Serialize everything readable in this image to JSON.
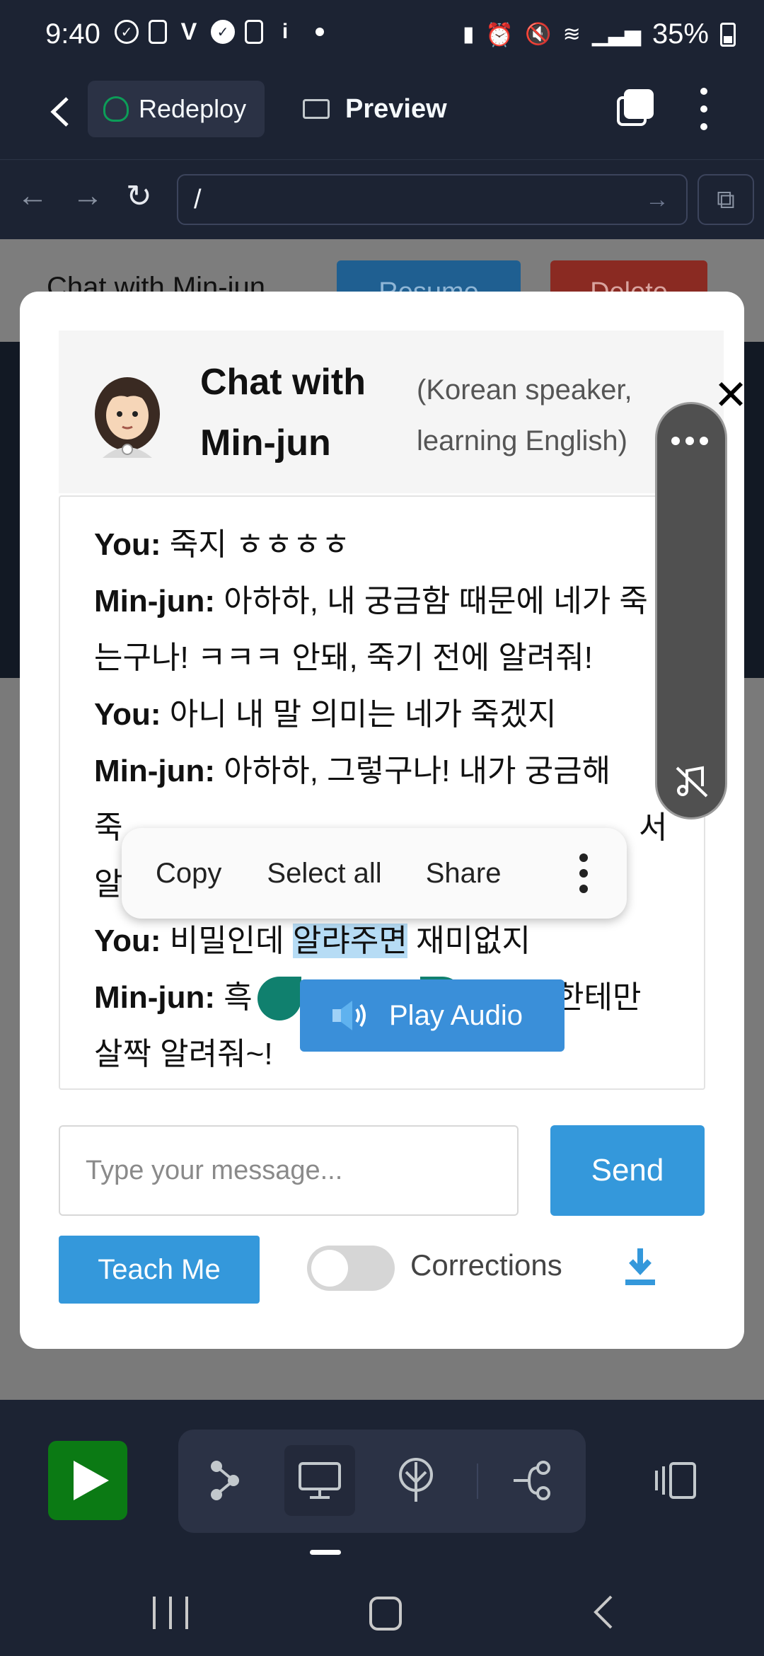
{
  "status_bar": {
    "time": "9:40",
    "battery": "35%"
  },
  "app_bar": {
    "redeploy_label": "Redeploy",
    "preview_label": "Preview"
  },
  "url_bar": {
    "path": "/"
  },
  "background_page": {
    "title": "Chat with Min-jun",
    "resume_label": "Resume",
    "delete_label": "Delete"
  },
  "chat": {
    "title": "Chat with Min-jun",
    "subtitle": "(Korean speaker, learning English)",
    "messages": [
      {
        "speaker": "You:",
        "text": " 죽지 ㅎㅎㅎㅎ"
      },
      {
        "speaker": "Min-jun:",
        "text": " 아하하, 내 궁금함 때문에 네가 죽는구나! ㅋㅋㅋ 안돼, 죽기 전에 알려줘!"
      },
      {
        "speaker": "You:",
        "text": " 아니 내 말 의미는 네가 죽겠지"
      },
      {
        "speaker": "Min-jun:",
        "text": " 아하하, 그렇구나! 내가 궁금해"
      },
      {
        "speaker": "You:",
        "text_before": " 비밀인데 ",
        "selected": "알랴주면",
        "text_after": " 재미없지"
      },
      {
        "speaker": "Min-jun:",
        "text_before": " 흑",
        "text_after": "한테만"
      },
      {
        "text": "살짝 알려줘~!"
      }
    ],
    "partial_line_1": "죽",
    "partial_line_1_end": "서",
    "partial_line_2": "알",
    "input_placeholder": "Type your message...",
    "send_label": "Send",
    "teach_label": "Teach Me",
    "corrections_label": "Corrections",
    "corrections_enabled": false
  },
  "selection_toolbar": {
    "items": [
      "Copy",
      "Select all",
      "Share"
    ]
  },
  "play_audio_label": "Play Audio",
  "colors": {
    "accent": "#3498db",
    "run_green": "#0b7a14",
    "handle": "#10806e",
    "dark_bg": "#1c2333"
  }
}
